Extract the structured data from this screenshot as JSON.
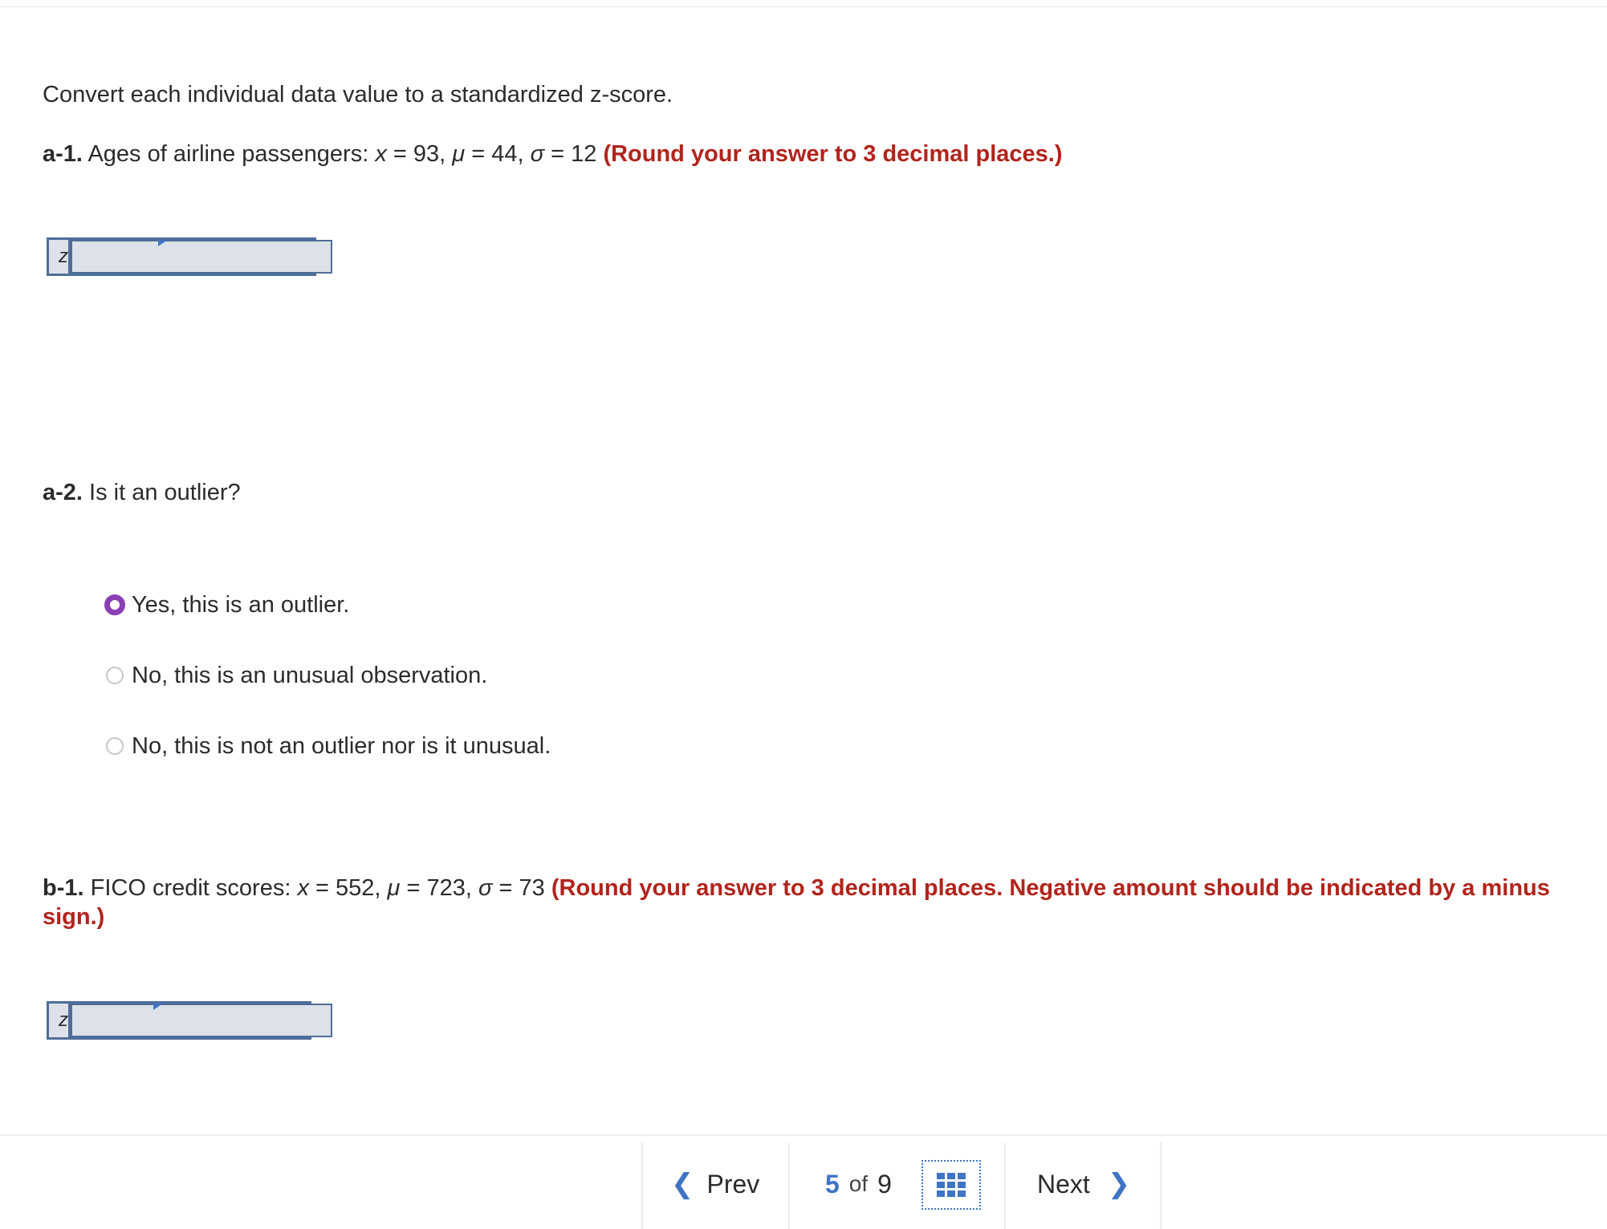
{
  "instructions": "Convert each individual data value to a standardized z-score.",
  "a1": {
    "label": "a-1.",
    "text_prefix": "Ages of airline passengers: ",
    "x_sym": "x",
    "x_val": " = 93, ",
    "mu_sym": "μ",
    "mu_val": " = 44, ",
    "sigma_sym": "σ",
    "sigma_val": " = 12 ",
    "note": "(Round your answer to 3 decimal places.)",
    "input_label": "z",
    "input_value": ""
  },
  "a2": {
    "label": "a-2.",
    "question": " Is it an outlier?",
    "options": [
      {
        "label": "Yes, this is an outlier.",
        "selected": true
      },
      {
        "label": "No, this is an unusual observation.",
        "selected": false
      },
      {
        "label": "No, this is not an outlier nor is it unusual.",
        "selected": false
      }
    ]
  },
  "b1": {
    "label": "b-1.",
    "text_prefix": " FICO credit scores: ",
    "x_sym": "x",
    "x_val": " = 552, ",
    "mu_sym": "μ",
    "mu_val": " = 723, ",
    "sigma_sym": "σ",
    "sigma_val": " = 73 ",
    "note": "(Round your answer to 3 decimal places. Negative amount should be indicated by a minus sign.)",
    "input_label": "z",
    "input_value": ""
  },
  "footer": {
    "prev_label": "Prev",
    "next_label": "Next",
    "current_page": "5",
    "of_label": "of",
    "total_pages": "9"
  },
  "colors": {
    "accent": "#3f74c4",
    "note_red": "#b1241c",
    "radio_selected": "#8b3fb5",
    "input_bg": "#dde2ea",
    "input_border": "#4f6d99"
  },
  "icons": [
    "chevron-left-icon",
    "chevron-right-icon",
    "question-grid-icon",
    "answer-flag-icon"
  ]
}
